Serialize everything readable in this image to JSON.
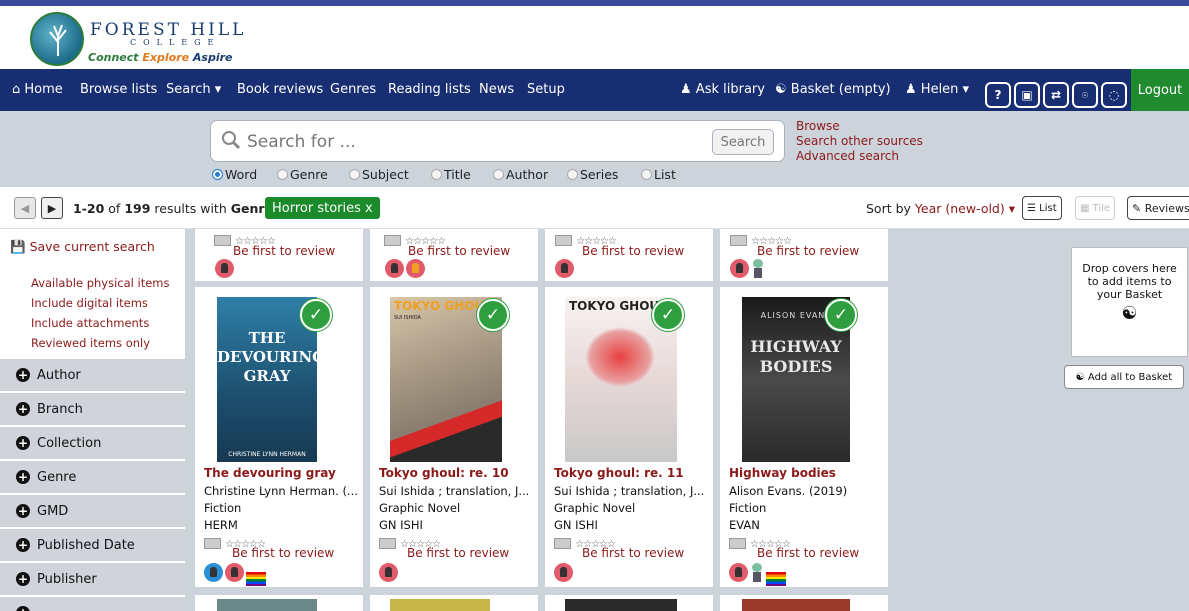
{
  "logo": {
    "name": "FOREST HILL",
    "sub": "COLLEGE",
    "tag_1": "Connect",
    "tag_2": "Explore",
    "tag_3": "Aspire"
  },
  "nav": {
    "home": "Home",
    "browse_lists": "Browse lists",
    "search": "Search ▾",
    "book_reviews": "Book reviews",
    "genres": "Genres",
    "reading_lists": "Reading lists",
    "news": "News",
    "setup": "Setup",
    "ask_library": "Ask library",
    "basket": "Basket (empty)",
    "user": "Helen ▾",
    "logout": "Logout"
  },
  "search": {
    "placeholder": "Search for ...",
    "button": "Search",
    "links": [
      "Browse",
      "Search other sources",
      "Advanced search"
    ],
    "modes": [
      "Word",
      "Genre",
      "Subject",
      "Title",
      "Author",
      "Series",
      "List"
    ],
    "selected_mode": "Word"
  },
  "results": {
    "range": "1-20",
    "of": "of",
    "total": "199",
    "suffix": "results with",
    "filter_field": "Genre",
    "equals": "=",
    "filter_value": "Horror stories x",
    "sort_label": "Sort by",
    "sort_value": "Year (new-old) ▾",
    "views": [
      "List",
      "Tile",
      "Reviews"
    ]
  },
  "sidebar": {
    "save_search": "Save current search",
    "filters": [
      "Available physical items",
      "Include digital items",
      "Include attachments",
      "Reviewed items only"
    ],
    "facets": [
      "Author",
      "Branch",
      "Collection",
      "Genre",
      "GMD",
      "Published Date",
      "Publisher"
    ]
  },
  "review_prompt": "Be first to review",
  "books": [
    {
      "title": "The devouring gray",
      "author": "Christine Lynn Herman. (...",
      "type": "Fiction",
      "call": "HERM",
      "cover_title": "THE DEVOURING GRAY",
      "cover_author": "CHRISTINE LYNN HERMAN"
    },
    {
      "title": "Tokyo ghoul: re. 10",
      "author": "Sui Ishida ; translation, J...",
      "type": "Graphic Novel",
      "call": "GN ISHI",
      "cover_title": "TOKYO GHOUL",
      "cover_author": "SUI ISHIDA"
    },
    {
      "title": "Tokyo ghoul: re. 11",
      "author": "Sui Ishida ; translation, J...",
      "type": "Graphic Novel",
      "call": "GN ISHI",
      "cover_title": "TOKYO GHOUL",
      "cover_author": ""
    },
    {
      "title": "Highway bodies",
      "author": "Alison Evans. (2019)",
      "type": "Fiction",
      "call": "EVAN",
      "cover_title": "HIGHWAY BODIES",
      "cover_author": "ALISON EVANS"
    }
  ],
  "basket_panel": {
    "drop_text": "Drop covers here to add items to your Basket",
    "add_all": "Add all to Basket"
  },
  "colors": {
    "nav": "#172e72",
    "accent_green": "#1a8a2a",
    "link_red": "#8b1a1a",
    "panel_grey": "#cdd3db"
  }
}
